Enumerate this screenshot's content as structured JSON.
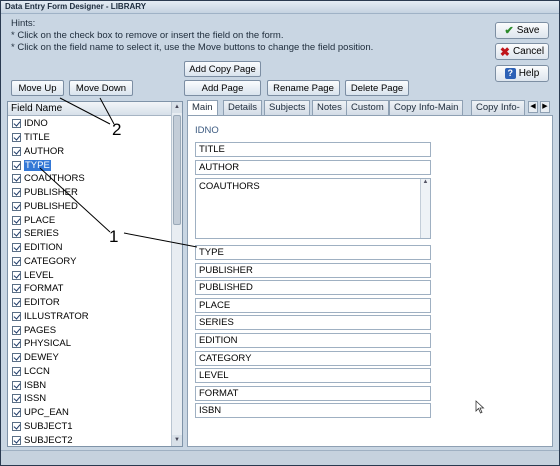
{
  "window": {
    "title": "Data Entry Form Designer - LIBRARY"
  },
  "hints": {
    "heading": "Hints:",
    "line1": "* Click on the check box to remove or insert the field on the form.",
    "line2": "* Click on the field name to select it, use the Move buttons to change the field position."
  },
  "toolbar": {
    "move_up": "Move Up",
    "move_down": "Move Down",
    "add_copy_page": "Add Copy Page",
    "add_page": "Add Page",
    "rename_page": "Rename Page",
    "delete_page": "Delete Page"
  },
  "side_buttons": {
    "save": "Save",
    "cancel": "Cancel",
    "help": "Help"
  },
  "field_list": {
    "header": "Field Name",
    "selected": "TYPE",
    "items": [
      "IDNO",
      "TITLE",
      "AUTHOR",
      "TYPE",
      "COAUTHORS",
      "PUBLISHER",
      "PUBLISHED",
      "PLACE",
      "SERIES",
      "EDITION",
      "CATEGORY",
      "LEVEL",
      "FORMAT",
      "EDITOR",
      "ILLUSTRATOR",
      "PAGES",
      "PHYSICAL",
      "DEWEY",
      "LCCN",
      "ISBN",
      "ISSN",
      "UPC_EAN",
      "SUBJECT1",
      "SUBJECT2"
    ]
  },
  "tabs": [
    "Main",
    "Details",
    "Subjects",
    "Notes",
    "Custom",
    "Copy Info-Main",
    "Copy Info-"
  ],
  "active_tab": "Main",
  "form": {
    "idno_label": "IDNO",
    "fields": [
      "TITLE",
      "AUTHOR"
    ],
    "memo": "COAUTHORS",
    "fields_below": [
      "TYPE",
      "PUBLISHER",
      "PUBLISHED",
      "PLACE",
      "SERIES",
      "EDITION",
      "CATEGORY",
      "LEVEL",
      "FORMAT",
      "ISBN"
    ]
  },
  "annotations": {
    "one": "1",
    "two": "2"
  },
  "colors": {
    "selection": "#3478d6",
    "save_check": "#2b8a2b",
    "cancel_x": "#c0151b"
  }
}
